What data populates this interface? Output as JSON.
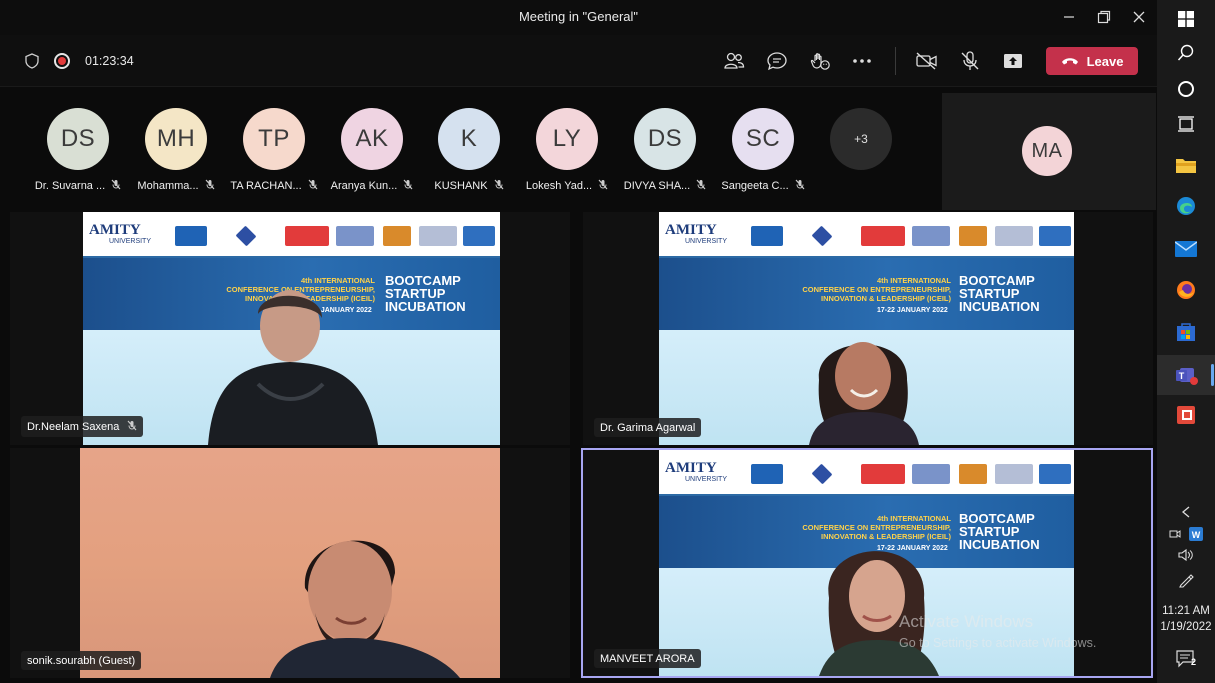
{
  "window": {
    "title": "Meeting in \"General\"",
    "minimize_icon": "minimize-icon",
    "restore_icon": "restore-icon",
    "close_icon": "close-icon"
  },
  "toolbar": {
    "timer": "01:23:34",
    "leave_label": "Leave",
    "icons": [
      "shield-icon",
      "recording-icon",
      "participants-icon",
      "chat-icon",
      "reactions-icon",
      "more-icon",
      "camera-off-icon",
      "mic-off-icon",
      "share-icon",
      "phone-icon"
    ],
    "recording_color": "#e23b3b",
    "leave_color": "#c4314b"
  },
  "participants": [
    {
      "initials": "DS",
      "name": "Dr. Suvarna ...",
      "color": "#d9dfd4"
    },
    {
      "initials": "MH",
      "name": "Mohamma...",
      "color": "#f4e6c6"
    },
    {
      "initials": "TP",
      "name": "TA RACHAN...",
      "color": "#f6d9cc"
    },
    {
      "initials": "AK",
      "name": "Aranya Kun...",
      "color": "#efd4e2"
    },
    {
      "initials": "K",
      "name": "KUSHANK",
      "color": "#d5e1ef"
    },
    {
      "initials": "LY",
      "name": "Lokesh Yad...",
      "color": "#f3d6da"
    },
    {
      "initials": "DS",
      "name": "DIVYA SHA...",
      "color": "#d8e4e6"
    },
    {
      "initials": "SC",
      "name": "Sangeeta C...",
      "color": "#e6dff0"
    }
  ],
  "more_participants": "+3",
  "self_view": {
    "initials": "MA",
    "color": "#f3d4d7"
  },
  "video_tiles": [
    {
      "name": "Dr.Neelam Saxena",
      "muted": true
    },
    {
      "name": "Dr. Garima Agarwal",
      "muted": false
    },
    {
      "name": "sonik.sourabh (Guest)",
      "muted": false
    },
    {
      "name": "MANVEET ARORA",
      "muted": false
    }
  ],
  "slide": {
    "university": "AMITY",
    "university_sub": "UNIVERSITY",
    "conference_line1": "4th INTERNATIONAL",
    "conference_line2": "CONFERENCE ON ENTREPRENEURSHIP,",
    "conference_line3": "INNOVATION & LEADERSHIP (ICEIL)",
    "dates": "17-22 JANUARY 2022",
    "bootcamp_line1": "BOOTCAMP",
    "bootcamp_line2": "STARTUP",
    "bootcamp_line3": "INCUBATION"
  },
  "watermark": {
    "line1": "Activate Windows",
    "line2": "Go to Settings to activate Windows."
  },
  "taskbar": {
    "apps": [
      "windows-start-icon",
      "search-icon",
      "cortana-icon",
      "task-view-icon",
      "file-explorer-icon",
      "edge-icon",
      "mail-icon",
      "firefox-icon",
      "store-icon",
      "teams-icon",
      "office-icon"
    ],
    "time": "11:21 AM",
    "date": "1/19/2022",
    "notification_count": "2"
  }
}
